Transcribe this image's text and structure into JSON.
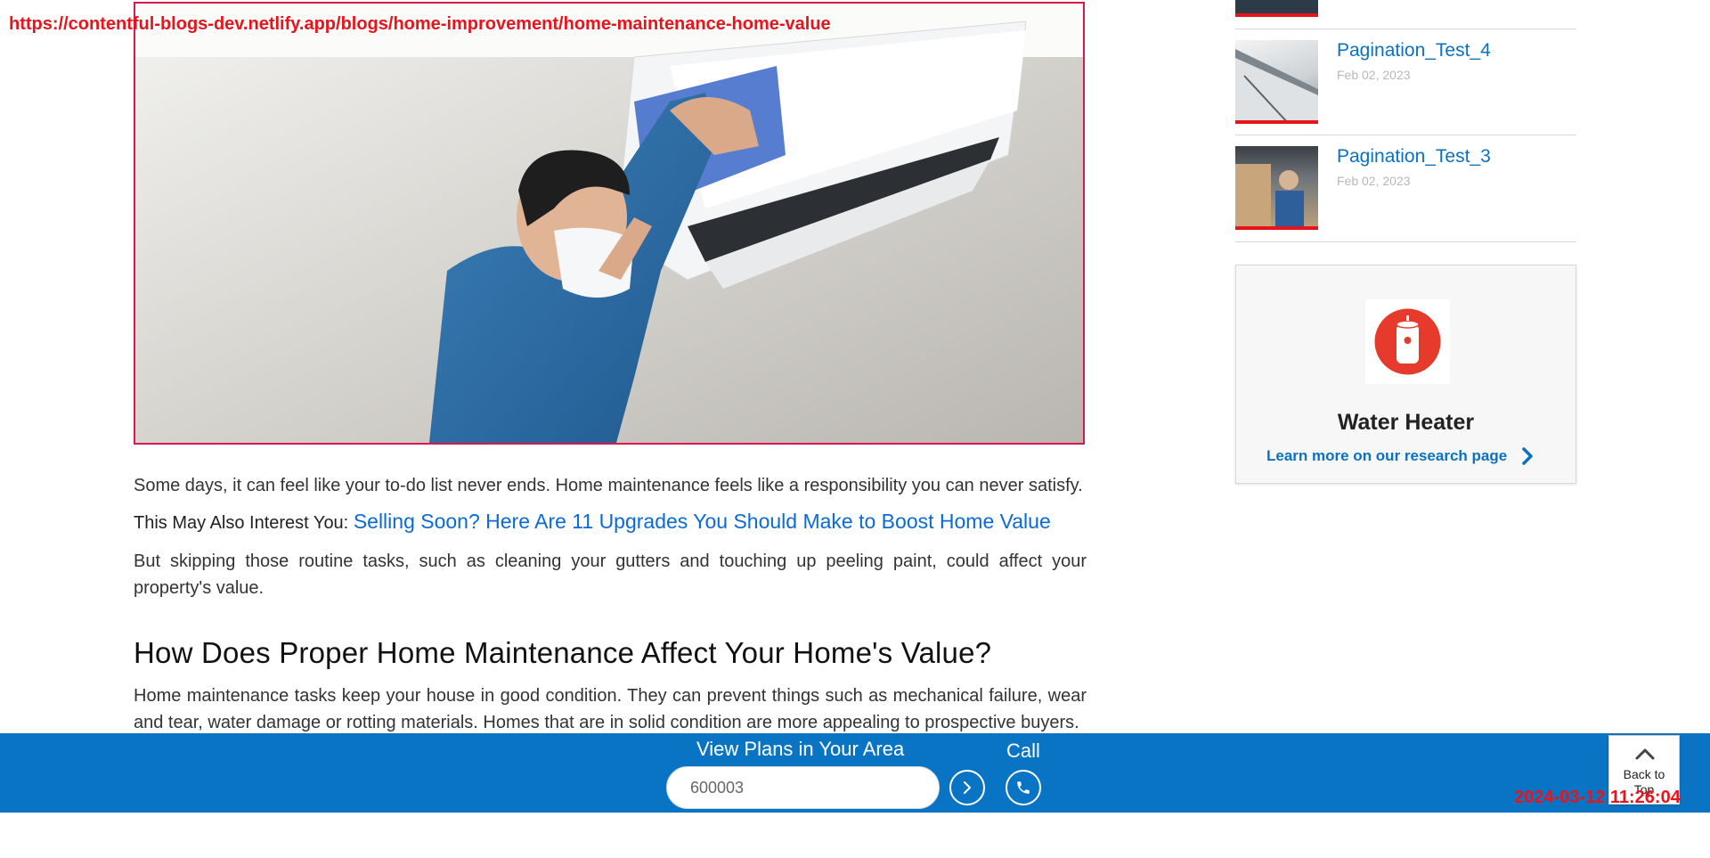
{
  "overlay": {
    "url": "https://contentful-blogs-dev.netlify.app/blogs/home-improvement/home-maintenance-home-value",
    "timestamp": "2024-03-12 11:26:04"
  },
  "article": {
    "intro": "Some days, it can feel like your to-do list never ends. Home maintenance feels like a responsibility you can never satisfy.",
    "interest_label": "This May Also Interest You:",
    "interest_link": "Selling Soon? Here Are 11 Upgrades You Should Make to Boost Home Value",
    "paragraph_2": "But skipping those routine tasks, such as cleaning your gutters and touching up peeling paint, could affect your property's value.",
    "heading": "How Does Proper Home Maintenance Affect Your Home's Value?",
    "paragraph_3": "Home maintenance tasks keep your house in good condition. They can prevent things such as mechanical failure, wear and tear, water damage or rotting materials. Homes that are in solid condition are more appealing to prospective buyers."
  },
  "sidebar": {
    "posts": [
      {
        "title": "Pagination_Test_4",
        "date": "Feb 02, 2023"
      },
      {
        "title": "Pagination_Test_3",
        "date": "Feb 02, 2023"
      }
    ],
    "promo": {
      "title": "Water Heater",
      "link": "Learn more on our research page"
    }
  },
  "bottom_bar": {
    "heading": "View Plans in Your Area",
    "zip_value": "600003",
    "call_label": "Call"
  },
  "back_to_top": {
    "line1": "Back to",
    "line2": "Top"
  },
  "colors": {
    "brand_blue": "#0a74c4",
    "link_blue": "#0a6ad8",
    "accent_red": "#e8141b"
  }
}
